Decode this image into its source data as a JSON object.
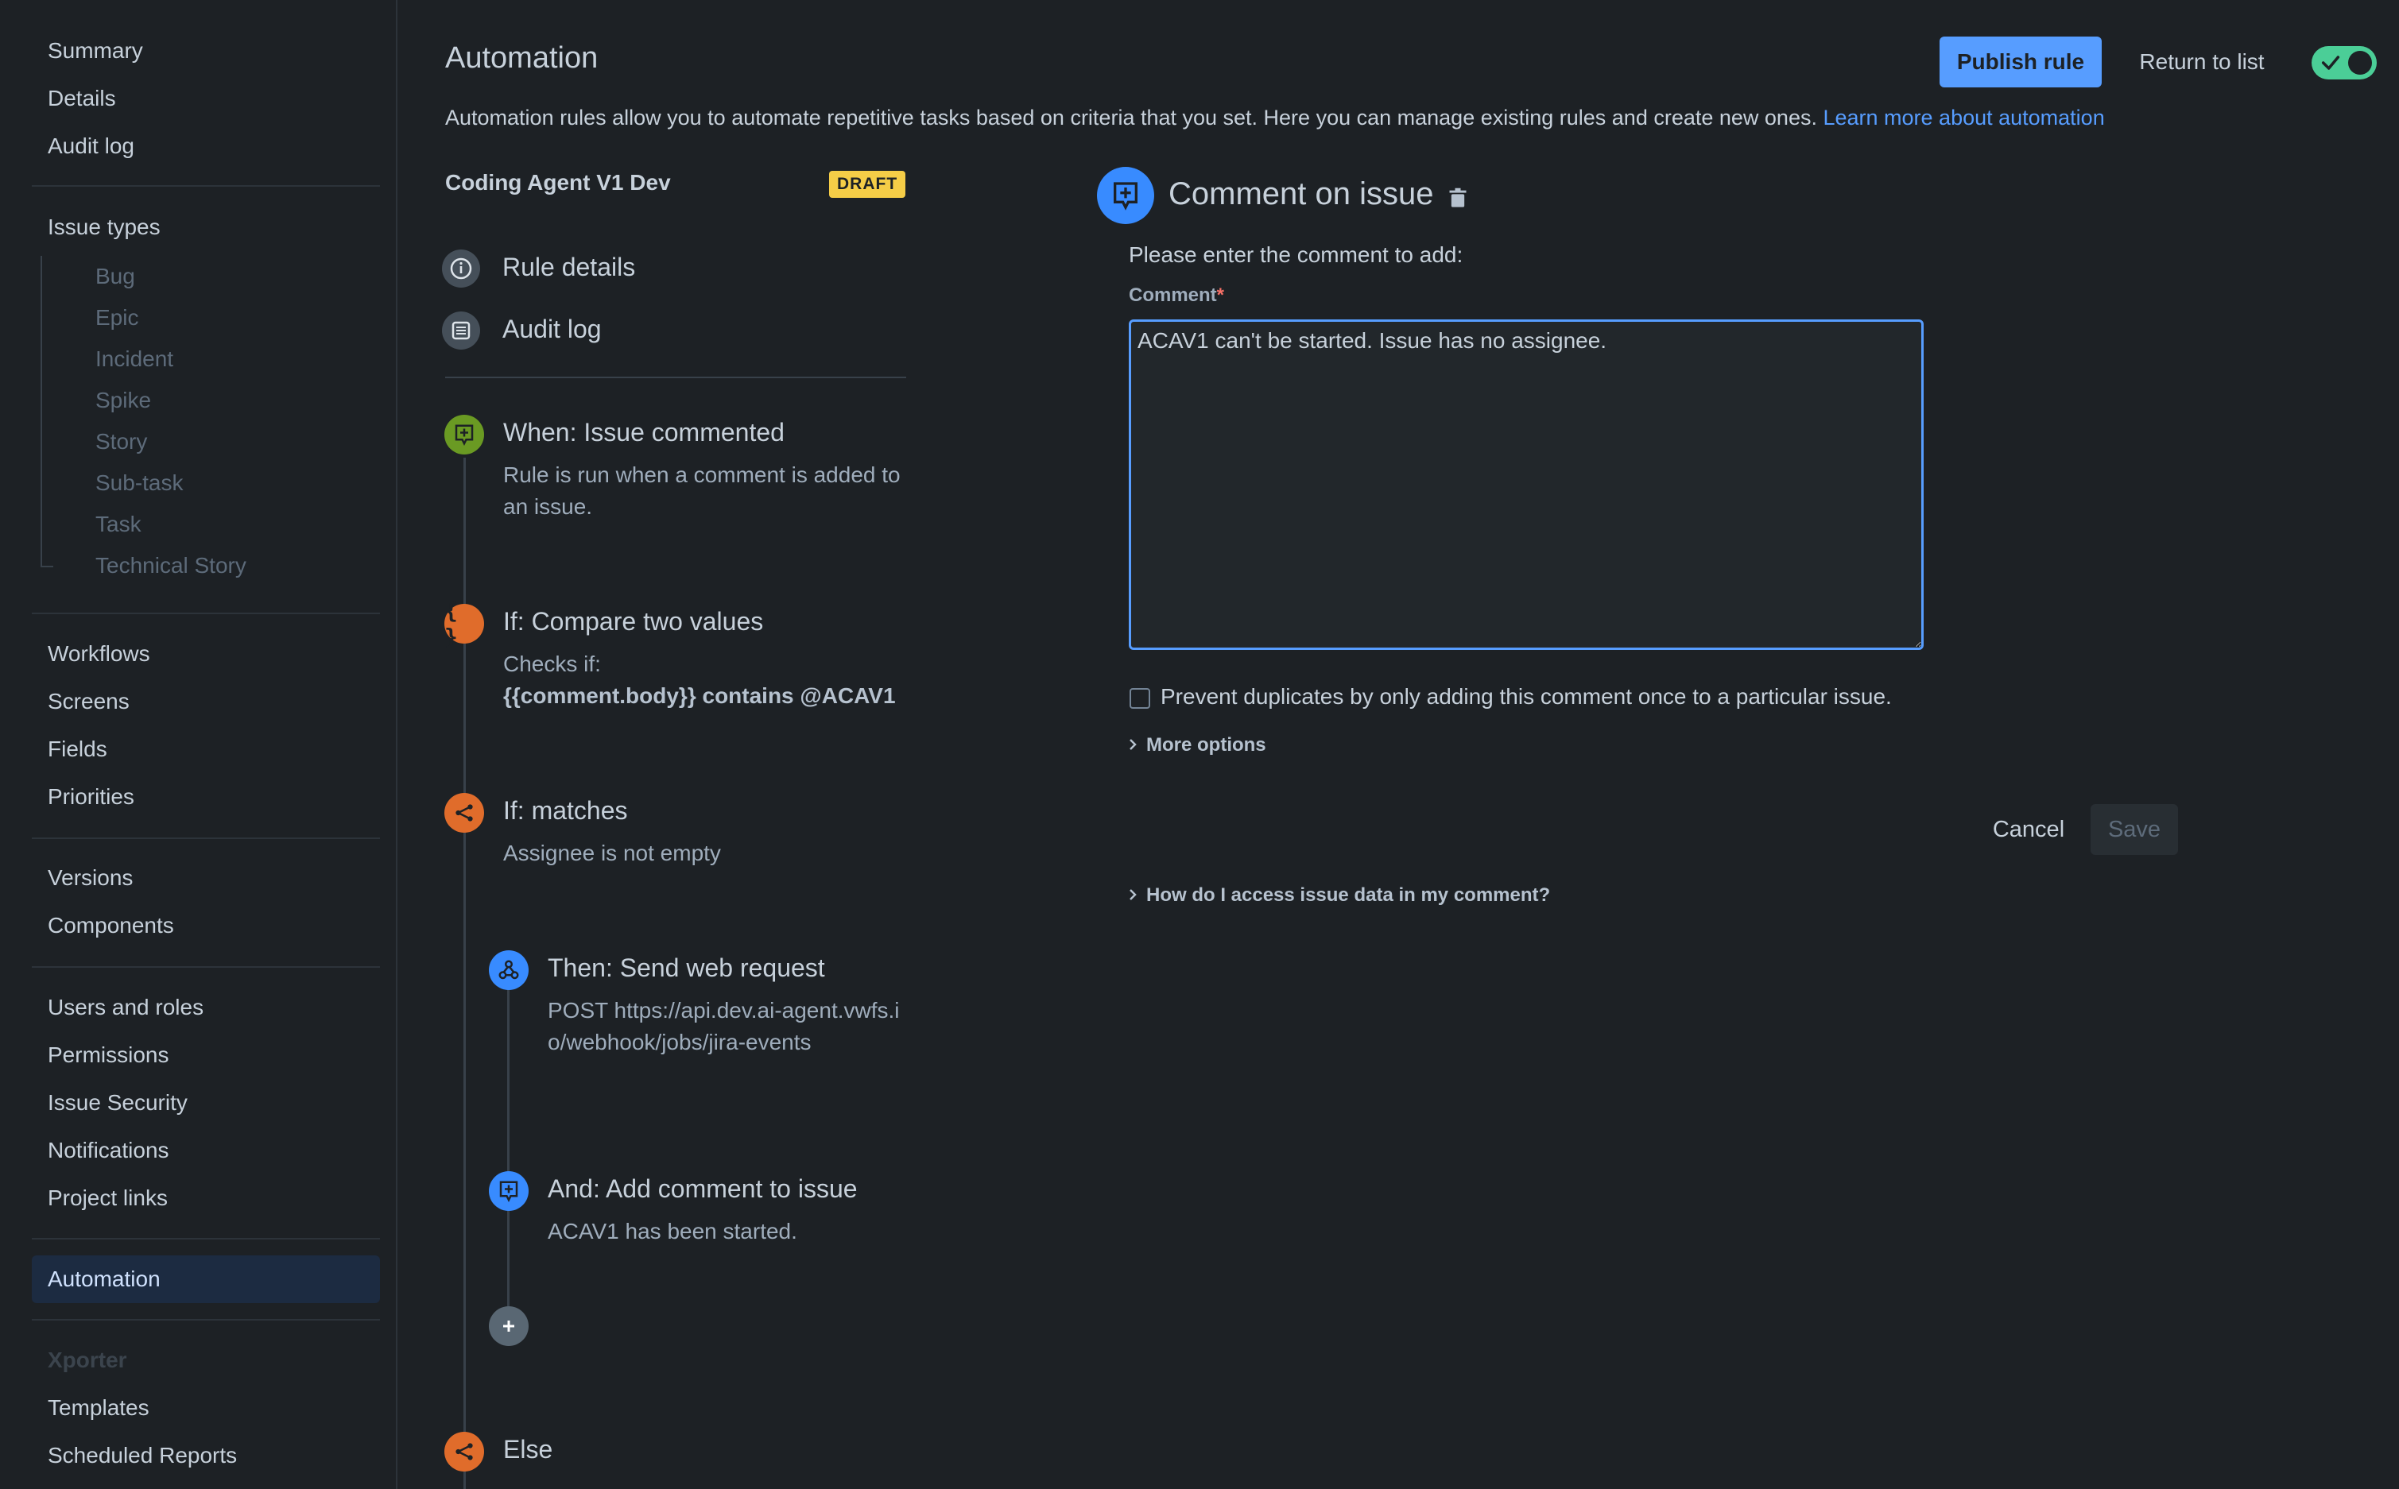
{
  "sidebar": {
    "top_items": [
      {
        "label": "Summary"
      },
      {
        "label": "Details"
      },
      {
        "label": "Audit log"
      }
    ],
    "issue_types_heading": "Issue types",
    "issue_types": [
      "Bug",
      "Epic",
      "Incident",
      "Spike",
      "Story",
      "Sub-task",
      "Task",
      "Technical Story"
    ],
    "config_items": [
      {
        "label": "Workflows"
      },
      {
        "label": "Screens"
      },
      {
        "label": "Fields"
      },
      {
        "label": "Priorities"
      }
    ],
    "release_items": [
      {
        "label": "Versions"
      },
      {
        "label": "Components"
      }
    ],
    "access_items": [
      {
        "label": "Users and roles"
      },
      {
        "label": "Permissions"
      },
      {
        "label": "Issue Security"
      },
      {
        "label": "Notifications"
      },
      {
        "label": "Project links"
      }
    ],
    "automation_label": "Automation",
    "xporter_heading": "Xporter",
    "xporter_items": [
      {
        "label": "Templates"
      },
      {
        "label": "Scheduled Reports"
      }
    ]
  },
  "header": {
    "title": "Automation",
    "description": "Automation rules allow you to automate repetitive tasks based on criteria that you set. Here you can manage existing rules and create new ones.",
    "learn_more": "Learn more about automation",
    "publish_label": "Publish rule",
    "return_label": "Return to list",
    "rule_enabled": true
  },
  "rule": {
    "name": "Coding Agent V1 Dev",
    "status": "DRAFT",
    "menu": [
      {
        "label": "Rule details"
      },
      {
        "label": "Audit log"
      }
    ],
    "steps": [
      {
        "title": "When: Issue commented",
        "desc": "Rule is run when a comment is added to an issue."
      },
      {
        "title": "If: Compare two values",
        "desc": "Checks if:",
        "desc_bold": "{{comment.body}} contains @ACAV1"
      },
      {
        "title": "If: matches",
        "desc": "Assignee is not empty"
      },
      {
        "title": "Then: Send web request",
        "desc": "POST https://api.dev.ai-agent.vwfs.io/webhook/jobs/jira-events"
      },
      {
        "title": "And: Add comment to issue",
        "desc": "ACAV1 has been started."
      },
      {
        "title": "Else"
      }
    ]
  },
  "panel": {
    "title": "Comment on issue",
    "prompt": "Please enter the comment to add:",
    "comment_label": "Comment",
    "required_mark": "*",
    "comment_value": "ACAV1 can't be started. Issue has no assignee.",
    "prevent_duplicates_label": "Prevent duplicates by only adding this comment once to a particular issue.",
    "prevent_duplicates_checked": false,
    "more_options": "More options",
    "cancel_label": "Cancel",
    "save_label": "Save",
    "help_link": "How do I access issue data in my comment?"
  },
  "colors": {
    "background": "#1d2125",
    "accent": "#579dff",
    "trigger": "#6a9a23",
    "condition": "#e06c2b",
    "action": "#388bff",
    "draft": "#f5cd47",
    "toggle_on": "#4bce97"
  }
}
